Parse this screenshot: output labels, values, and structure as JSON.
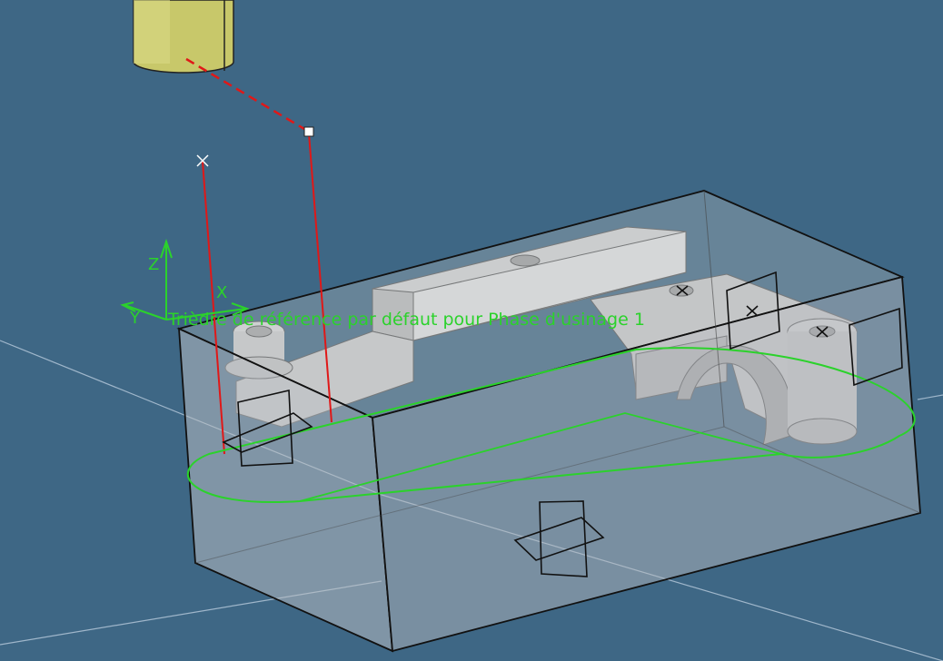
{
  "viewer": {
    "background_color": "#3e6785",
    "axis_system": {
      "z_label": "Z",
      "x_label": "X",
      "y_label": "Y",
      "color": "#2bd22b"
    },
    "reference_triad_label": "Trièdre de référence par défaut pour Phase d'usinage 1",
    "colors": {
      "tool_holder": "#cccc6a",
      "toolpath": "#e01818",
      "machining_area": "#2bd22b",
      "stock_edges": "#111111",
      "part": "#c4c4c4"
    },
    "icons": [
      "tool-holder-icon",
      "approach-point-icon",
      "start-point-icon",
      "plane-marker-icon"
    ]
  }
}
